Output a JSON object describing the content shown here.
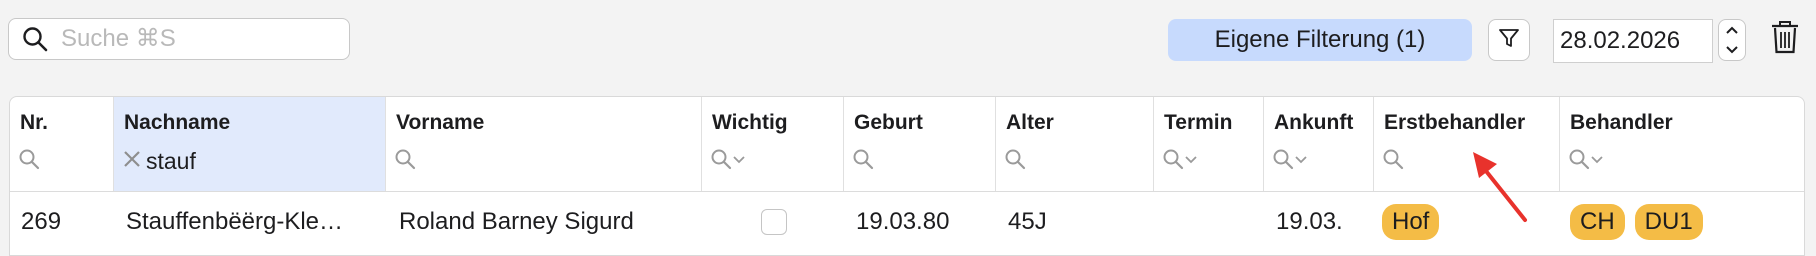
{
  "toolbar": {
    "search_placeholder": "Suche ⌘S",
    "search_value": "",
    "filter_button_label": "Eigene Filterung (1)",
    "date_value": "28.02.2026",
    "accent_color": "#c7dafd"
  },
  "table": {
    "columns": [
      {
        "key": "nr",
        "label": "Nr."
      },
      {
        "key": "nachname",
        "label": "Nachname",
        "filter_value": "stauf"
      },
      {
        "key": "vorname",
        "label": "Vorname"
      },
      {
        "key": "wichtig",
        "label": "Wichtig"
      },
      {
        "key": "geburt",
        "label": "Geburt"
      },
      {
        "key": "alter",
        "label": "Alter"
      },
      {
        "key": "termin",
        "label": "Termin"
      },
      {
        "key": "ankunft",
        "label": "Ankunft"
      },
      {
        "key": "erstbehandler",
        "label": "Erstbehandler"
      },
      {
        "key": "behandler",
        "label": "Behandler"
      }
    ],
    "rows": [
      {
        "nr": "269",
        "nachname": "Stauffenbëërg-Kle…",
        "vorname": "Roland Barney Sigurd",
        "wichtig": false,
        "geburt": "19.03.80",
        "alter": "45J",
        "termin": "",
        "ankunft": "19.03.",
        "erstbehandler": [
          "Hof"
        ],
        "behandler": [
          "CH",
          "DU1"
        ]
      }
    ],
    "badge_color": "#f4bc46",
    "active_column_color": "#e1eafc"
  },
  "icons": {
    "search": "search-icon",
    "funnel": "funnel-icon",
    "stepper_up": "chevron-up-icon",
    "stepper_down": "chevron-down-icon",
    "trash": "trash-icon",
    "clear": "clear-x-icon",
    "annotation_arrow": "red-arrow-icon"
  }
}
